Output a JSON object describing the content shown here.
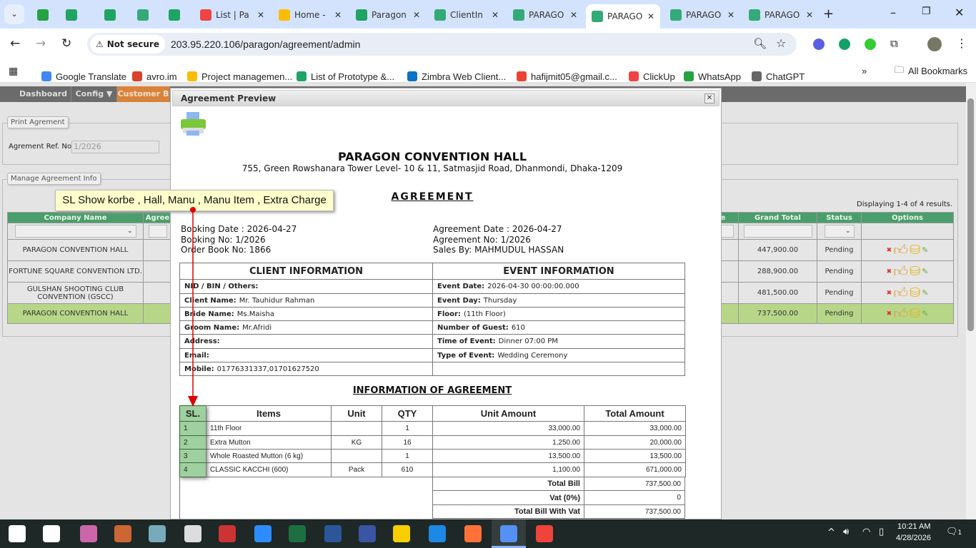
{
  "browser": {
    "tabs": [
      {
        "label": "",
        "icon": "whatsapp-icon",
        "color": "#25a244"
      },
      {
        "label": "",
        "icon": "sheets-icon",
        "color": "#1fa463"
      },
      {
        "label": "",
        "icon": "sheets-icon",
        "color": "#1fa463"
      },
      {
        "label": "",
        "icon": "app-icon",
        "color": "#3a7"
      },
      {
        "label": "",
        "icon": "sheets-icon",
        "color": "#1fa463"
      },
      {
        "label": "List | Pa",
        "icon": "clickup-icon",
        "color": "#e44"
      },
      {
        "label": "Home -",
        "icon": "drive-icon",
        "color": "#fbbc04"
      },
      {
        "label": "Paragon",
        "icon": "sheets-icon",
        "color": "#1fa463"
      },
      {
        "label": "ClientIn",
        "icon": "app-icon",
        "color": "#3a7"
      },
      {
        "label": "PARAGO",
        "icon": "app-icon",
        "color": "#3a7"
      },
      {
        "label": "PARAGO",
        "icon": "app-icon",
        "color": "#3a7",
        "active": true
      },
      {
        "label": "PARAGO",
        "icon": "app-icon",
        "color": "#3a7"
      },
      {
        "label": "PARAGO",
        "icon": "app-icon",
        "color": "#3a7"
      }
    ],
    "not_secure": "Not secure",
    "url": "203.95.220.106/paragon/agreement/admin",
    "bookmarks": [
      "Google Translate",
      "avro.im",
      "Project managemen...",
      "List of Prototype &...",
      "Zimbra Web Client...",
      "hafijmit05@gmail.c...",
      "ClickUp",
      "WhatsApp",
      "ChatGPT"
    ],
    "all_bookmarks": "All Bookmarks"
  },
  "nav": {
    "items": [
      "Dashboard",
      "Config ▼",
      "Customer B"
    ],
    "active_color": "#d9823b"
  },
  "print_agreement": {
    "legend": "Print Agrement",
    "ref_label": "Agrement Ref. No",
    "ref_value": "1/2026"
  },
  "manage": {
    "legend": "Manage Agreement Info",
    "displaying": "Displaying 1-4 of 4 results.",
    "headers": {
      "company": "Company Name",
      "agree": "Agree",
      "event": "e",
      "grand_total": "Grand Total",
      "status": "Status",
      "options": "Options"
    },
    "rows": [
      {
        "company": "PARAGON CONVENTION HALL",
        "event": "ion",
        "grand_total": "447,900.00",
        "status": "Pending"
      },
      {
        "company": "FORTUNE SQUARE CONVENTION LTD.",
        "event": "ion",
        "grand_total": "288,900.00",
        "status": "Pending"
      },
      {
        "company": "GULSHAN SHOOTING CLUB CONVENTION (GSCC)",
        "event": "",
        "grand_total": "481,500.00",
        "status": "Pending"
      },
      {
        "company": "PARAGON CONVENTION HALL",
        "event": "ony",
        "grand_total": "737,500.00",
        "status": "Pending",
        "highlight": true
      }
    ],
    "header_color": "#4a9e6c",
    "highlight_color": "#b8d687"
  },
  "modal": {
    "title": "Agreement Preview",
    "company": "PARAGON CONVENTION HALL",
    "address": "755, Green Rowshanara Tower Level- 10 & 11, Satmasjid Road, Dhanmondi, Dhaka-1209",
    "heading": "AGREEMENT",
    "left_info": [
      "Booking Date : 2026-04-27",
      "Booking No: 1/2026",
      "Order Book No: 1866"
    ],
    "right_info": [
      "Agreement Date : 2026-04-27",
      "Agreement No: 1/2026",
      "Sales By: MAHMUDUL HASSAN"
    ],
    "client_header": "CLIENT INFORMATION",
    "event_header": "EVENT INFORMATION",
    "client": [
      {
        "label": "NID / BIN / Others:",
        "value": ""
      },
      {
        "label": "Client Name:",
        "value": "Mr. Tauhidur Rahman"
      },
      {
        "label": "Bride Name:",
        "value": "Ms.Maisha"
      },
      {
        "label": "Groom Name:",
        "value": "Mr.Afridi"
      },
      {
        "label": "Address:",
        "value": ""
      },
      {
        "label": "Email:",
        "value": ""
      },
      {
        "label": "Mobile:",
        "value": "01776331337,01701627520"
      }
    ],
    "event": [
      {
        "label": "Event Date:",
        "value": "2026-04-30 00:00:00.000"
      },
      {
        "label": "Event Day:",
        "value": "Thursday"
      },
      {
        "label": "Floor:",
        "value": "(11th Floor)"
      },
      {
        "label": "Number of Guest:",
        "value": "610"
      },
      {
        "label": "Time of Event:",
        "value": "Dinner 07:00 PM"
      },
      {
        "label": "Type of Event:",
        "value": "Wedding Ceremony"
      },
      {
        "label": "",
        "value": ""
      }
    ],
    "info_heading": "INFORMATION OF AGREEMENT",
    "item_headers": [
      "SL.",
      "Items",
      "Unit",
      "QTY",
      "Unit Amount",
      "Total Amount"
    ],
    "items": [
      [
        "1",
        "11th Floor",
        "",
        "1",
        "33,000.00",
        "33,000.00"
      ],
      [
        "2",
        "Extra Mutton",
        "KG",
        "16",
        "1,250.00",
        "20,000.00"
      ],
      [
        "3",
        "Whole Roasted Mutton (6 kg)",
        "",
        "1",
        "13,500.00",
        "13,500.00"
      ],
      [
        "4",
        "CLASSIC KACCHI (600)",
        "Pack",
        "610",
        "1,100.00",
        "671,000.00"
      ]
    ],
    "totals": [
      {
        "label": "Total Bill",
        "value": "737,500.00"
      },
      {
        "label": "Vat (0%)",
        "value": "0"
      },
      {
        "label": "Total Bill With Vat",
        "value": "737,500.00"
      }
    ]
  },
  "annotation": {
    "text": "SL Show korbe , Hall, Manu , Manu Item , Extra Charge",
    "color": "#e00000"
  },
  "taskbar": {
    "time": "10:21 AM",
    "date": "4/28/2026",
    "notifications": "1"
  }
}
